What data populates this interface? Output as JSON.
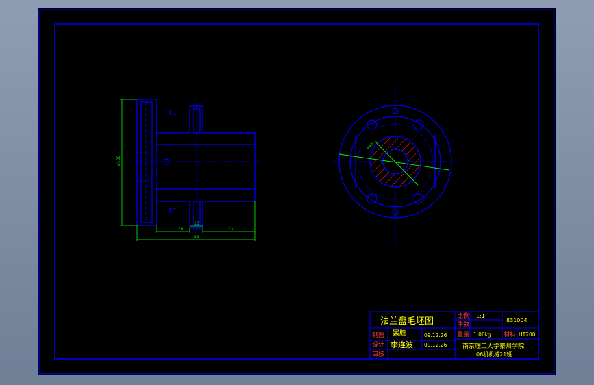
{
  "title_block": {
    "drawing_title": "法兰盘毛坯图",
    "scale_label": "比例",
    "scale_value": "1:1",
    "sheet_label": "件数",
    "drawing_number": "831004",
    "weight_label": "重量",
    "weight_value": "1.06kg",
    "material_label": "材料",
    "material_value": "HT200",
    "drawn_label": "制图",
    "drawn_name": "罢胜",
    "drawn_date": "09.12.26",
    "design_label": "设计",
    "design_name": "李连波",
    "design_date": "09.12.26",
    "review_label": "审核",
    "school": "南京理工大学泰州学院",
    "class_name": "06机机械21班"
  },
  "dimensions": {
    "diameter_left": "ø100",
    "dim_a": "45",
    "dim_b": "16",
    "dim_c": "41",
    "dim_total": "89",
    "dim_radial": "ø45"
  },
  "colors": {
    "sheet": "#000000",
    "frame": "#0000ff",
    "part": "#0000ff",
    "dimension": "#00ff00",
    "hatch": "#ff2020",
    "text": "#ffff00"
  }
}
